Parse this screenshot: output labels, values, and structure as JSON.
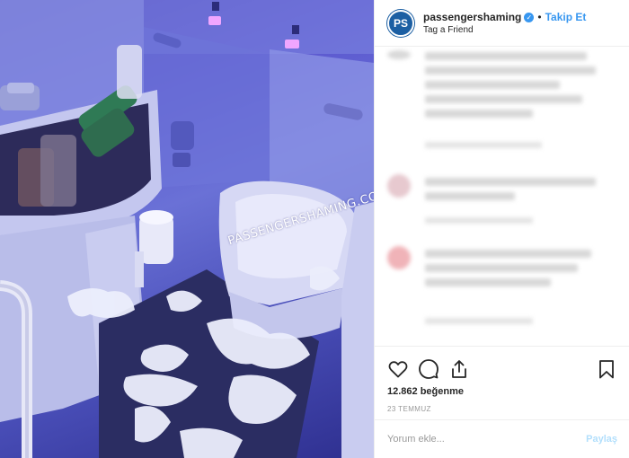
{
  "post": {
    "image_description_icon": "photo",
    "watermark": "PASSENGERSHAMING.COM"
  },
  "header": {
    "avatar_text": "PS",
    "username": "passengershaming",
    "follow_label": "Takip Et",
    "subtitle": "Tag a Friend",
    "separator": "•"
  },
  "actions": {
    "like_icon": "heart-icon",
    "comment_icon": "comment-icon",
    "share_icon": "share-icon",
    "save_icon": "bookmark-icon",
    "likes_text": "12.862 beğenme",
    "date_text": "23 TEMMUZ"
  },
  "comment_box": {
    "placeholder": "Yorum ekle...",
    "post_label": "Paylaş"
  },
  "colors": {
    "accent": "#3897f0",
    "avatar_bg": "#1c5fa3",
    "post_disabled": "#b2dffc"
  }
}
